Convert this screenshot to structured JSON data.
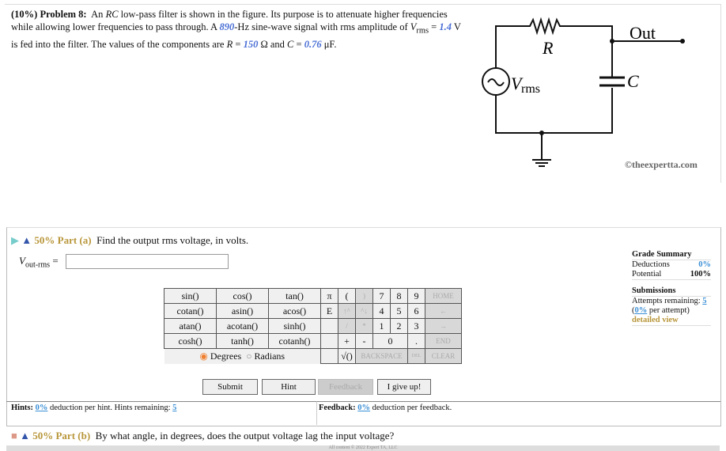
{
  "problem": {
    "weight": "(10%)",
    "label": "Problem 8:",
    "t1": "An ",
    "rc": "RC",
    "t2": " low-pass filter is shown in the figure. Its purpose is to attenuate higher frequencies while allowing lower frequencies to pass through. A ",
    "freq": "890",
    "t3": "-Hz sine-wave signal with rms amplitude of ",
    "vsym": "V",
    "vsub": "rms",
    "t4": " = ",
    "v": "1.4",
    "t5": " V is fed into the filter. The values of the components are ",
    "rsym": "R",
    "t6": " = ",
    "r": "150",
    "t7": " Ω and ",
    "csym": "C",
    "t8": " = ",
    "c": "0.76",
    "t9": " μF."
  },
  "figure": {
    "out": "Out",
    "r": "R",
    "c": "C",
    "v": "V",
    "vsub": "rms",
    "copyright": "©theexpertta.com"
  },
  "part_a": {
    "pct": "50% Part (a)",
    "question": "Find the output rms voltage, in volts.",
    "var": "V",
    "varsub": "out-rms",
    "eq": " =",
    "value": ""
  },
  "keypad": {
    "funcs": [
      [
        "sin()",
        "cos()",
        "tan()"
      ],
      [
        "cotan()",
        "asin()",
        "acos()"
      ],
      [
        "atan()",
        "acotan()",
        "sinh()"
      ],
      [
        "cosh()",
        "tanh()",
        "cotanh()"
      ]
    ],
    "pi": "π",
    "e": "E",
    "lp": "(",
    "rp": ")",
    "up": "↑^",
    "dn": "^↓",
    "div": "/",
    "mul": "*",
    "plus": "+",
    "minus": "-",
    "sqrt": "√()",
    "dot": ".",
    "home": "HOME",
    "left": "←",
    "right": "→",
    "end": "END",
    "back": "BACKSPACE",
    "del": "DEL",
    "clear": "CLEAR",
    "digits": [
      "7",
      "8",
      "9",
      "4",
      "5",
      "6",
      "1",
      "2",
      "3",
      "0"
    ],
    "degrees": "Degrees",
    "radians": "Radians"
  },
  "buttons": {
    "submit": "Submit",
    "hint": "Hint",
    "feedback": "Feedback",
    "giveup": "I give up!"
  },
  "hints": {
    "label": "Hints:",
    "pct": "0%",
    "t1": " deduction per hint. Hints remaining:",
    "rem": "5"
  },
  "feedback": {
    "label": "Feedback:",
    "pct": "0%",
    "t1": " deduction per feedback."
  },
  "grade": {
    "title": "Grade Summary",
    "deductions_label": "Deductions",
    "deductions": "0%",
    "potential_label": "Potential",
    "potential": "100%",
    "sub_title": "Submissions",
    "attempts_label": "Attempts remaining:",
    "attempts": "5",
    "per_pct": "0%",
    "per_text": " per attempt)",
    "detailed": "detailed view"
  },
  "part_b": {
    "pct": "50% Part (b)",
    "question": "By what angle, in degrees, does the output voltage lag the input voltage?"
  },
  "footer": "All content © 2022 Expert TA, LLC"
}
